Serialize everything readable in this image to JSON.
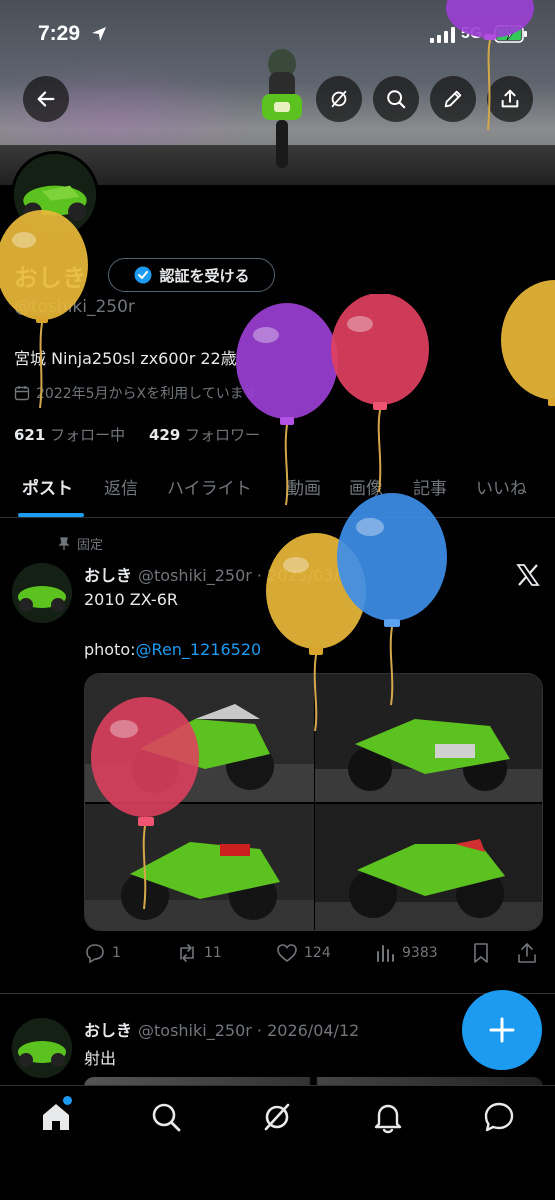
{
  "status_bar": {
    "time": "7:29",
    "network": "5G"
  },
  "profile": {
    "name": "おしき",
    "verify_label": "認証を受ける",
    "handle": "@toshiki_250r",
    "bio": "宮城 Ninja250sl zx600r 22歳",
    "joined": "2022年5月からXを利用しています",
    "following_count": "621",
    "following_label": "フォロー中",
    "followers_count": "429",
    "followers_label": "フォロワー"
  },
  "tabs": [
    {
      "label": "ポスト",
      "active": true
    },
    {
      "label": "返信"
    },
    {
      "label": "ハイライト"
    },
    {
      "label": "動画"
    },
    {
      "label": "画像"
    },
    {
      "label": "記事"
    },
    {
      "label": "いいね"
    }
  ],
  "posts": [
    {
      "pinned_label": "固定",
      "name": "おしき",
      "meta": "@toshiki_250r · 2025/03/02",
      "text": "2010 ZX-6R",
      "photo_prefix": "photo:",
      "mention": "@Ren_1216520",
      "replies": "1",
      "reposts": "11",
      "likes": "124",
      "views": "9383"
    },
    {
      "name": "おしき",
      "meta": "@toshiki_250r · 2026/04/12",
      "text": "射出"
    }
  ],
  "colors": {
    "accent": "#1d9bf0",
    "background": "#000000",
    "secondary_text": "#71767b",
    "bike_green": "#5cc21f"
  },
  "icons": [
    "back-arrow-icon",
    "grok-icon",
    "search-icon",
    "edit-pencil-icon",
    "share-icon",
    "verified-badge-icon",
    "calendar-icon",
    "pin-icon",
    "x-logo-icon",
    "reply-icon",
    "repost-icon",
    "like-icon",
    "views-icon",
    "bookmark-icon",
    "home-icon",
    "bell-icon",
    "messages-icon",
    "plus-icon"
  ]
}
